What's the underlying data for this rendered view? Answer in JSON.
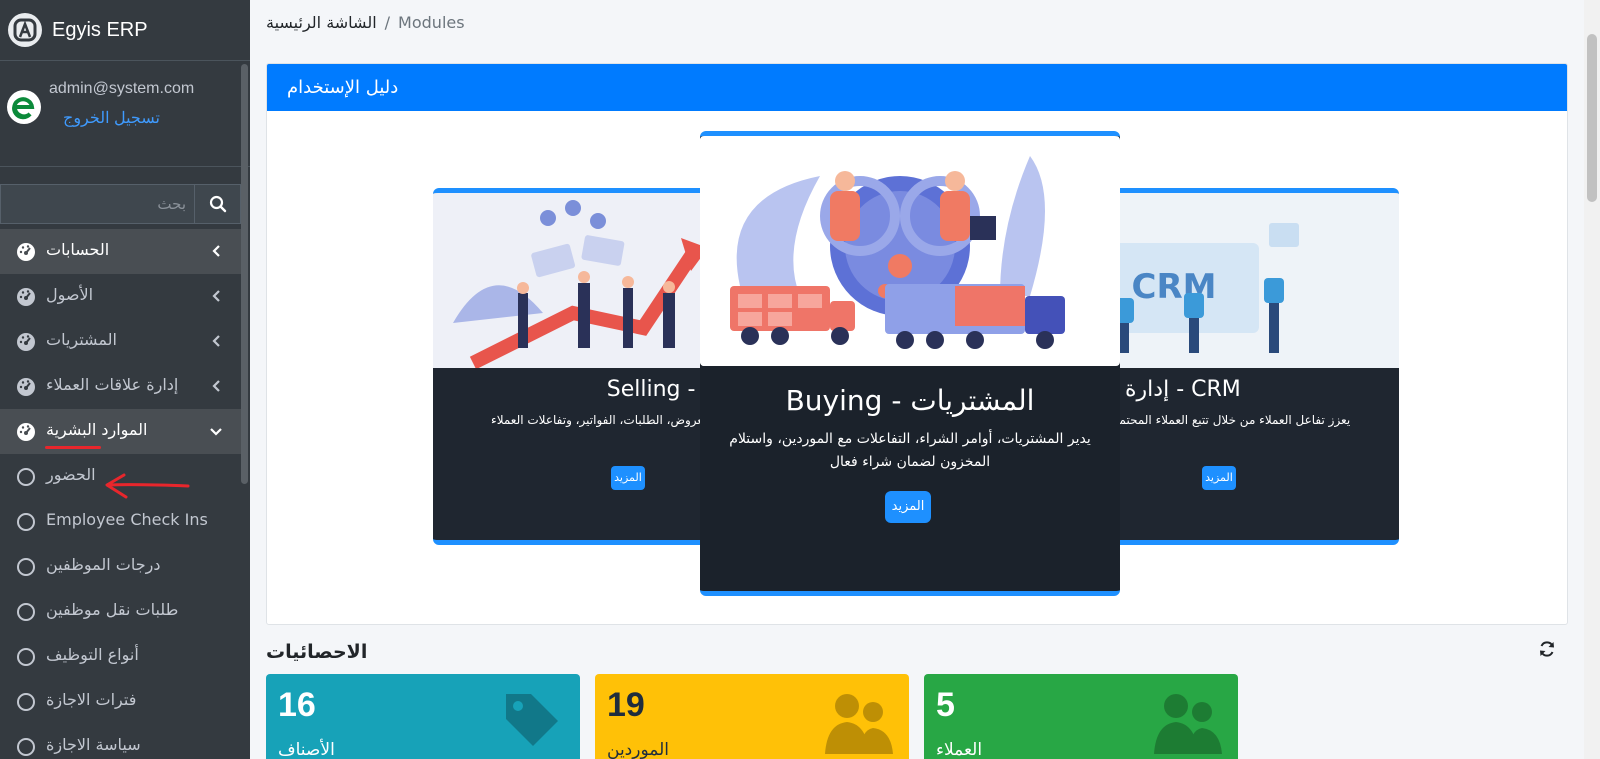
{
  "brand": {
    "name": "Egyis ERP"
  },
  "user": {
    "email": "admin@system.com",
    "logout": "تسجيل الخروج"
  },
  "search": {
    "placeholder": "بحث"
  },
  "nav": {
    "items": [
      {
        "label": "الحسابات"
      },
      {
        "label": "الأصول"
      },
      {
        "label": "المشتريات"
      },
      {
        "label": "إدارة علاقات العملاء"
      },
      {
        "label": "الموارد البشرية"
      }
    ],
    "sub_items": [
      {
        "label": "الحضور"
      },
      {
        "label": "Employee Check Ins"
      },
      {
        "label": "درجات الموظفين"
      },
      {
        "label": "طلبات نقل موظفين"
      },
      {
        "label": "أنواع التوظيف"
      },
      {
        "label": "فترات الاجازة"
      },
      {
        "label": "سياسة الاجازة"
      }
    ]
  },
  "breadcrumb": {
    "home": "الشاشة الرئيسية",
    "separator": "/",
    "current": "Modules"
  },
  "guide": {
    "header": "دليل الإستخدام",
    "slides": {
      "left": {
        "title": "Selling - المبيعات",
        "desc": "عملية البيع من خلال إدارة العروض، الطلبات، الفواتير، وتفاعلات العملاء",
        "more": "المزيد"
      },
      "center": {
        "title": "Buying - المشتريات",
        "desc": "يدير المشتريات، أوامر الشراء، التفاعلات مع الموردين، واستلام المخزون لضمان شراء فعال",
        "more": "المزيد"
      },
      "right": {
        "title": "إدارة علاقات العملاء - CRM",
        "desc": "يعزز تفاعل العملاء من خلال تتبع العملاء المحتملين، و المتابعات وتحليل بيانات العملاء",
        "more": "المزيد"
      }
    }
  },
  "stats": {
    "title": "الاحصائيات",
    "boxes": [
      {
        "value": "16",
        "label": "الأصناف",
        "color": "#17a2b8",
        "icon": "tags-icon"
      },
      {
        "value": "19",
        "label": "الموردين",
        "color": "#ffc107",
        "icon": "users-icon"
      },
      {
        "value": "5",
        "label": "العملاء",
        "color": "#28a745",
        "icon": "users-icon"
      }
    ]
  },
  "colors": {
    "accent": "#007bff",
    "sidebar": "#343a40",
    "annotation": "#e8262c"
  }
}
